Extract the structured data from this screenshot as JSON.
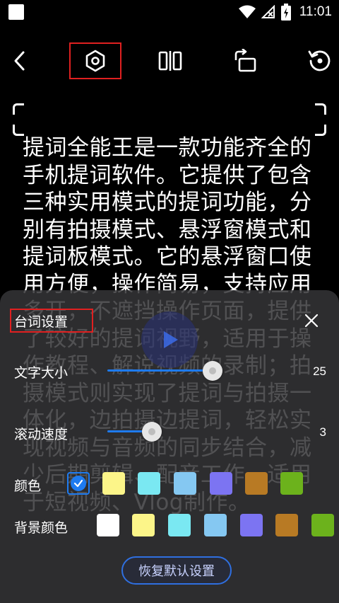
{
  "status_bar": {
    "time": "11:01",
    "icons": [
      "notification-square-icon",
      "wifi-icon",
      "no-signal-icon",
      "battery-charging-icon"
    ]
  },
  "toolbar": {
    "buttons": [
      {
        "name": "back",
        "icon": "chevron-left-icon"
      },
      {
        "name": "settings",
        "icon": "hexagon-settings-icon"
      },
      {
        "name": "mirror",
        "icon": "mirror-flip-icon"
      },
      {
        "name": "rotate",
        "icon": "rotate-screen-icon"
      },
      {
        "name": "reset",
        "icon": "restore-icon"
      }
    ]
  },
  "script": {
    "text": "提词全能王是一款功能齐全的手机提词软件。它提供了包含三种实用模式的提词功能，分别有拍摄模式、悬浮窗模式和提词板模式。它的悬浮窗口使用方便，操作简易，支持应用多开，不遮挡操作页面，提供了较好的提词视野，适用于操作教程、解说视频的录制；拍摄模式则实现了提词与拍摄一体化，边拍摄边提词，轻松实现视频与音频的同步结合，减少后期剪辑、配音工作，适用于短视频、Vlog制作。"
  },
  "settings_panel": {
    "title": "台词设置",
    "font_size": {
      "label": "文字大小",
      "value": "25",
      "fraction": 0.57
    },
    "scroll_speed": {
      "label": "滚动速度",
      "value": "3",
      "fraction": 0.24
    },
    "color": {
      "label": "颜色",
      "options": [
        "#1e7bf0",
        "#fcf589",
        "#7ae8f2",
        "#85c8f2",
        "#7c74f2",
        "#b87a24",
        "#6cb21c"
      ],
      "selected_index": 0
    },
    "bg_color": {
      "label": "背景颜色",
      "options": [
        "#ffffff",
        "#fcf589",
        "#7ae8f2",
        "#85c8f2",
        "#7c74f2",
        "#b87a24",
        "#6cb21c"
      ]
    },
    "reset_label": "恢复默认设置"
  }
}
